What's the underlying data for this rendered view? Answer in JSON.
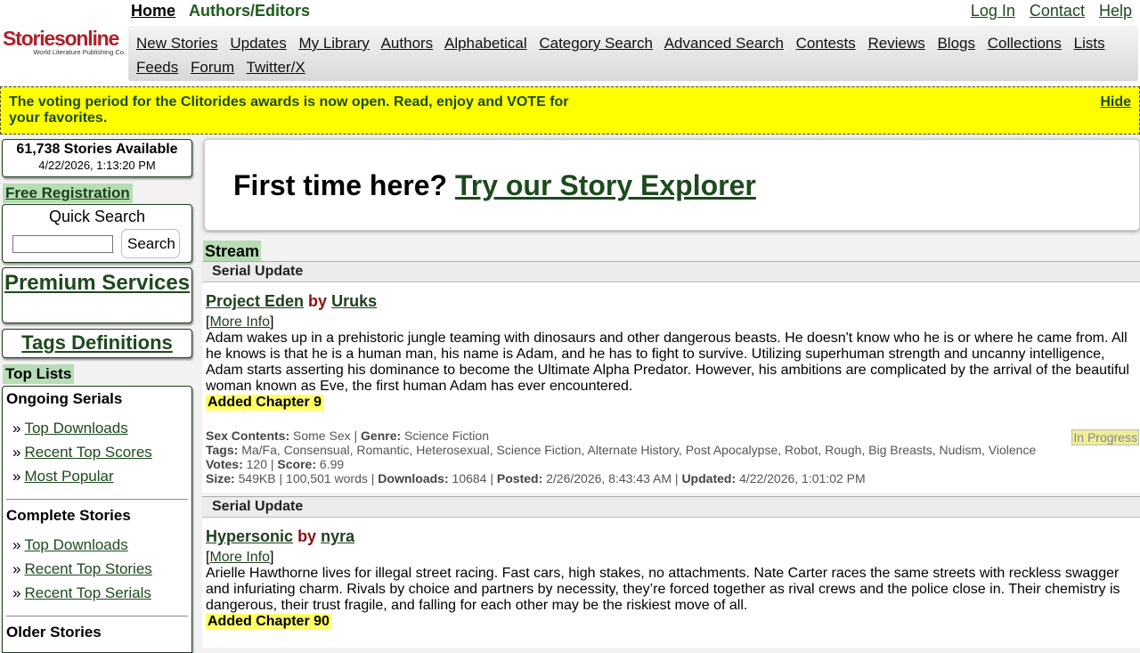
{
  "header": {
    "logo_text": "Storiesonline",
    "logo_subtext": "World Literature Publishing Co.",
    "top_left": {
      "home": "Home",
      "authors": "Authors/Editors"
    },
    "top_right": [
      "Log In",
      "Contact",
      "Help"
    ],
    "nav": [
      "New Stories",
      "Updates",
      "My Library",
      "Authors",
      "Alphabetical",
      "Category Search",
      "Advanced Search",
      "Contests",
      "Reviews",
      "Blogs",
      "Collections",
      "Lists",
      "Feeds",
      "Forum",
      "Twitter/X"
    ]
  },
  "banner": {
    "message": "The voting period for the Clitorides awards is now open. Read, enjoy and VOTE for your favorites.",
    "hide_label": "Hide",
    "color": "#ffff00"
  },
  "sidebar": {
    "stories_count": "61,738 Stories Available",
    "date": "4/22/2026, 1:13:20 PM",
    "free_registration": "Free Registration",
    "quick_search": {
      "title": "Quick Search",
      "value": "",
      "button": "Search"
    },
    "premium": "Premium Services",
    "tags": "Tags Definitions",
    "top_lists_label": "Top Lists",
    "groups": [
      {
        "title": "Ongoing Serials",
        "items": [
          "Top Downloads",
          "Recent Top Scores",
          "Most Popular"
        ]
      },
      {
        "title": "Complete Stories",
        "items": [
          "Top Downloads",
          "Recent Top Stories",
          "Recent Top Serials"
        ]
      },
      {
        "title": "Older Stories",
        "items": []
      }
    ],
    "bullet": "»"
  },
  "explorer": {
    "prefix": "First time here?",
    "link": "Try our Story Explorer"
  },
  "stream": {
    "label": "Stream",
    "entries": [
      {
        "type": "Serial Update",
        "title": "Project Eden",
        "by": "by",
        "author": "Uruks",
        "more_info": "More Info",
        "description": "Adam wakes up in a prehistoric jungle teaming with dinosaurs and other dangerous beasts. He doesn't know who he is or where he came from. All he knows is that he is a human man, his name is Adam, and he has to fight to survive. Utilizing superhuman strength and uncanny intelligence, Adam starts asserting his dominance to become the Ultimate Alpha Predator. However, his ambitions are complicated by the arrival of the beautiful woman known as Eve, the first human Adam has ever encountered.",
        "added": "Added Chapter 9",
        "status": "In Progress",
        "meta": {
          "sex_label": "Sex Contents:",
          "sex": "Some Sex",
          "genre_label": "Genre:",
          "genre": "Science Fiction",
          "tags_label": "Tags:",
          "tags": "Ma/Fa, Consensual, Romantic, Heterosexual, Science Fiction, Alternate History, Post Apocalypse, Robot, Rough, Big Breasts, Nudism, Violence",
          "votes_label": "Votes:",
          "votes": "120",
          "score_label": "Score:",
          "score": "6.99",
          "size_label": "Size:",
          "size": "549KB | 100,501 words",
          "downloads_label": "Downloads:",
          "downloads": "10684",
          "posted_label": "Posted:",
          "posted": "2/26/2026, 8:43:43 AM",
          "updated_label": "Updated:",
          "updated": "4/22/2026, 1:01:02 PM"
        }
      },
      {
        "type": "Serial Update",
        "title": "Hypersonic",
        "by": "by",
        "author": "nyra",
        "more_info": "More Info",
        "description": "Arielle Hawthorne lives for illegal street racing. Fast cars, high stakes, no attachments. Nate Carter races the same streets with reckless swagger and infuriating charm. Rivals by choice and partners by necessity, they’re forced together as rival crews and the police close in. Their chemistry is dangerous, their trust fragile, and falling for each other may be the riskiest move of all.",
        "added": "Added Chapter 90"
      }
    ]
  }
}
